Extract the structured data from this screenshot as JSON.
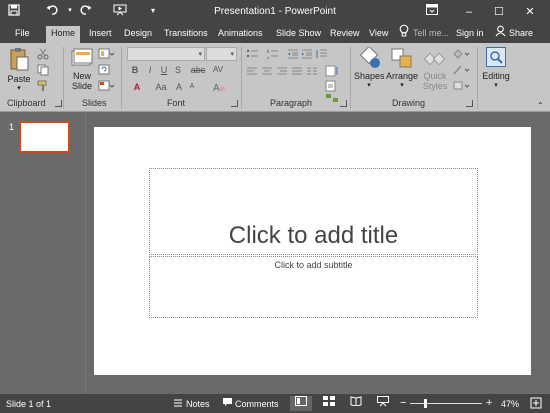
{
  "titlebar": {
    "title": "Presentation1 - PowerPoint",
    "qa": {
      "save": "save-icon",
      "undo": "undo-icon",
      "redo": "redo-icon",
      "presenter": "slideshow-from-start-icon",
      "customize": "customize-toolbar-icon"
    },
    "window": {
      "restore_ribbon": "ribbon-display-icon",
      "minimize": "–",
      "maximize": "☐",
      "close": "✕"
    }
  },
  "tabs": [
    "File",
    "Home",
    "Insert",
    "Design",
    "Transitions",
    "Animations",
    "Slide Show",
    "Review",
    "View"
  ],
  "active_tab": "Home",
  "tell_me": "Tell me...",
  "sign_in": "Sign in",
  "share": "Share",
  "ribbon": {
    "clipboard": {
      "label": "Clipboard",
      "paste": "Paste"
    },
    "slides": {
      "label": "Slides",
      "new_slide": "New",
      "new_slide2": "Slide"
    },
    "font": {
      "label": "Font",
      "bold": "B",
      "italic": "I",
      "underline": "U",
      "shadow": "S",
      "strike": "abc",
      "spacing": "AV",
      "case": "Aa",
      "grow": "A",
      "shrink": "A",
      "color": "A"
    },
    "paragraph": {
      "label": "Paragraph"
    },
    "drawing": {
      "label": "Drawing",
      "shapes": "Shapes",
      "arrange": "Arrange",
      "quick": "Quick",
      "styles": "Styles"
    },
    "editing": {
      "label": "Editing"
    }
  },
  "thumbnails": {
    "number": "1"
  },
  "slide": {
    "title": "Click to add title",
    "subtitle": "Click to add subtitle"
  },
  "status": {
    "slide_of": "Slide 1 of 1",
    "notes": "Notes",
    "comments": "Comments",
    "zoom": "47%",
    "zoom_minus": "−",
    "zoom_plus": "+",
    "accent": "#d04a1c"
  }
}
